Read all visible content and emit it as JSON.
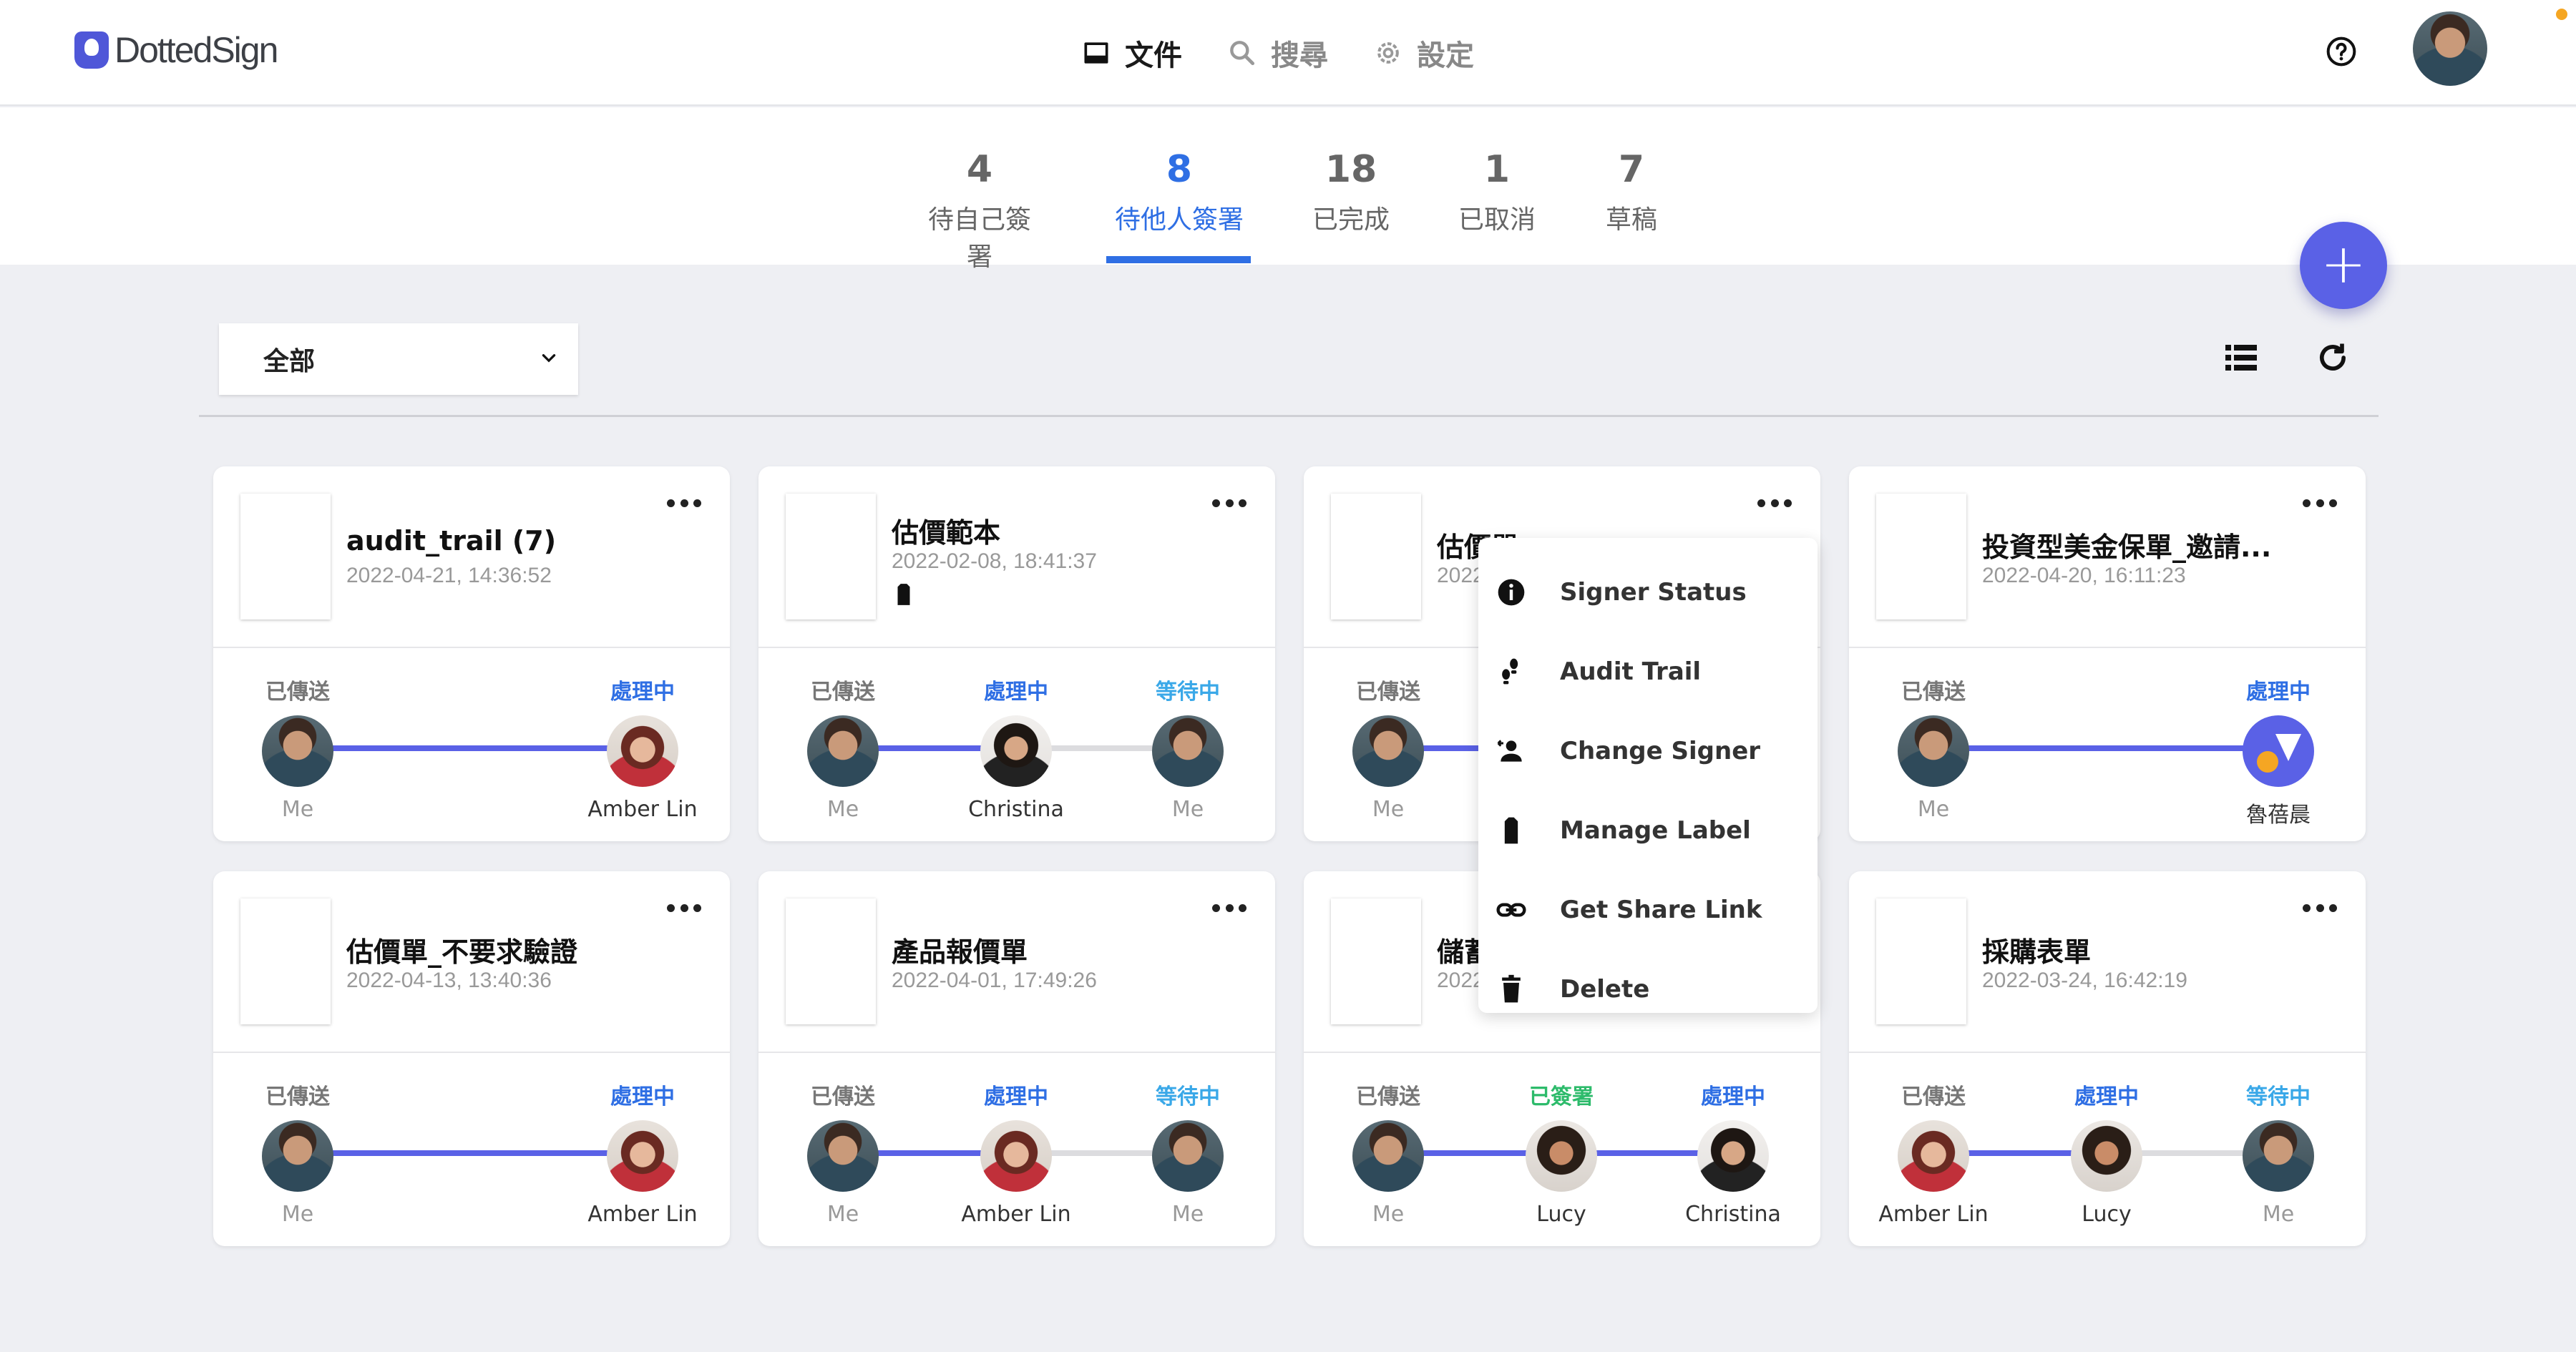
{
  "header": {
    "logo_text": "DottedSign",
    "nav": [
      {
        "label": "文件",
        "icon": "inbox-icon",
        "active": true
      },
      {
        "label": "搜尋",
        "icon": "search-icon",
        "active": false
      },
      {
        "label": "設定",
        "icon": "gear-icon",
        "active": false
      }
    ]
  },
  "tabs": [
    {
      "count": "4",
      "label": "待自己簽署",
      "active": false
    },
    {
      "count": "8",
      "label": "待他人簽署",
      "active": true
    },
    {
      "count": "18",
      "label": "已完成",
      "active": false
    },
    {
      "count": "1",
      "label": "已取消",
      "active": false
    },
    {
      "count": "7",
      "label": "草稿",
      "active": false
    }
  ],
  "filter": {
    "selected": "全部"
  },
  "colors": {
    "accent": "#5a61e6",
    "active_tab": "#2f6fe4",
    "processing": "#2f6fe4",
    "waiting": "#3aa8e8",
    "signed": "#2dbb6b"
  },
  "cards": [
    {
      "title": "audit_trail (7)",
      "date": "2022-04-21, 14:36:52",
      "signers": [
        {
          "state": "已傳送",
          "name": "Me"
        },
        {
          "state": "處理中",
          "name": "Amber Lin"
        }
      ]
    },
    {
      "title": "估價範本",
      "date": "2022-02-08, 18:41:37",
      "has_label": true,
      "signers": [
        {
          "state": "已傳送",
          "name": "Me"
        },
        {
          "state": "處理中",
          "name": "Christina"
        },
        {
          "state": "等待中",
          "name": "Me"
        }
      ]
    },
    {
      "title": "估價單",
      "date": "2022",
      "title_visible": "估價單",
      "date_visible": "2022",
      "signers": [
        {
          "state": "已傳送",
          "name": "Me"
        }
      ]
    },
    {
      "title": "投資型美金保單_邀請...",
      "date": "2022-04-20, 16:11:23",
      "signers": [
        {
          "state": "已傳送",
          "name": "Me"
        },
        {
          "state": "處理中",
          "name": "魯蓓晨"
        }
      ]
    },
    {
      "title": "估價單_不要求驗證",
      "date": "2022-04-13, 13:40:36",
      "signers": [
        {
          "state": "已傳送",
          "name": "Me"
        },
        {
          "state": "處理中",
          "name": "Amber Lin"
        }
      ]
    },
    {
      "title": "產品報價單",
      "date": "2022-04-01, 17:49:26",
      "signers": [
        {
          "state": "已傳送",
          "name": "Me"
        },
        {
          "state": "處理中",
          "name": "Amber Lin"
        },
        {
          "state": "等待中",
          "name": "Me"
        }
      ]
    },
    {
      "title": "儲蓄",
      "date": "2022",
      "signers": [
        {
          "state": "已傳送",
          "name": "Me"
        },
        {
          "state": "已簽署",
          "name": "Lucy"
        },
        {
          "state": "處理中",
          "name": "Christina"
        }
      ]
    },
    {
      "title": "採購表單",
      "date": "2022-03-24, 16:42:19",
      "signers": [
        {
          "state": "已傳送",
          "name": "Amber Lin"
        },
        {
          "state": "處理中",
          "name": "Lucy"
        },
        {
          "state": "等待中",
          "name": "Me"
        }
      ]
    }
  ],
  "context_menu": [
    {
      "label": "Signer Status",
      "icon": "info-icon"
    },
    {
      "label": "Audit Trail",
      "icon": "footsteps-icon"
    },
    {
      "label": "Change Signer",
      "icon": "person-swap-icon"
    },
    {
      "label": "Manage Label",
      "icon": "label-icon"
    },
    {
      "label": "Get Share Link",
      "icon": "link-icon"
    },
    {
      "label": "Delete",
      "icon": "trash-icon"
    }
  ]
}
